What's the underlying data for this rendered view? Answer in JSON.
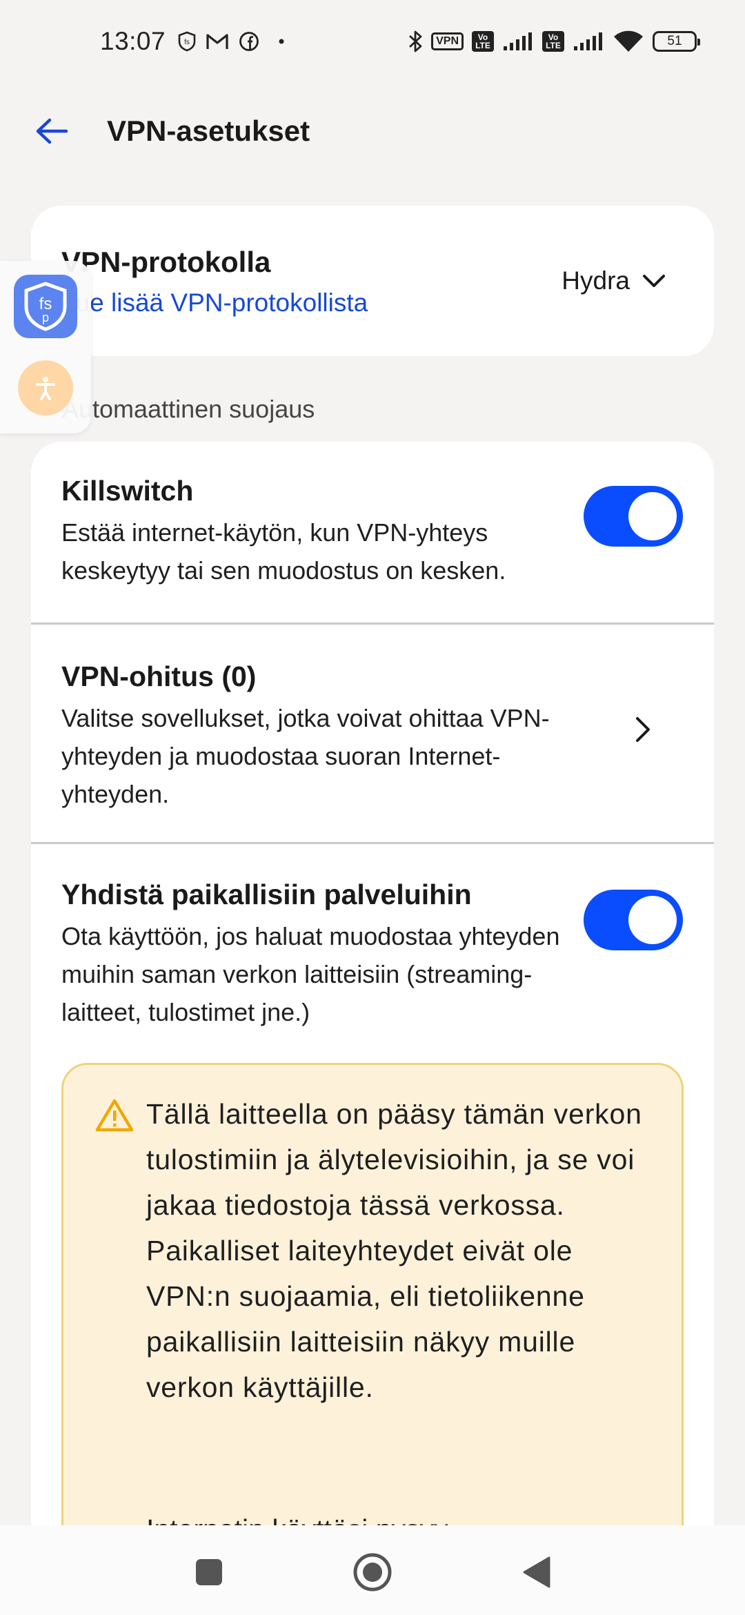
{
  "status_bar": {
    "time": "13:07",
    "vpn_badge": "VPN",
    "volte_1": "Vo\nLTE",
    "volte_2": "Vo\nLTE",
    "battery": "51",
    "icons_left": [
      "shield-fsp-icon",
      "gmail-icon",
      "facebook-icon",
      "dot-icon"
    ],
    "icons_right": [
      "bluetooth-icon",
      "vpn-icon",
      "volte-icon",
      "signal-icon",
      "volte-icon",
      "signal-icon",
      "wifi-icon",
      "battery-icon"
    ]
  },
  "header": {
    "title": "VPN-asetukset",
    "back_icon": "arrow-left-icon"
  },
  "protocol": {
    "title": "VPN-protokolla",
    "link": "Lue lisää VPN-protokollista",
    "selected": "Hydra"
  },
  "section": {
    "label": "Automaattinen suojaus"
  },
  "settings": {
    "killswitch": {
      "title": "Killswitch",
      "desc": "Estää internet-käytön, kun VPN-yhteys keskeytyy tai sen muodostus on kesken.",
      "enabled": true
    },
    "bypass": {
      "title": "VPN-ohitus (0)",
      "desc": "Valitse sovellukset, jotka voivat ohittaa VPN-yhteyden ja muodostaa suoran Internet-yhteyden."
    },
    "local": {
      "title": "Yhdistä paikallisiin palveluihin",
      "desc": "Ota käyttöön, jos haluat muodostaa yhteyden muihin saman verkon laitteisiin (streaming-laitteet, tulostimet jne.)",
      "enabled": true
    }
  },
  "warning": {
    "text": "Tällä laitteella on pääsy tämän verkon tulostimiin ja älytelevisioihin, ja se voi jakaa tiedostoja tässä verkossa. Paikalliset laiteyhteydet eivät ole VPN:n suojaamia, eli tietoliikenne paikallisiin laitteisiin näkyy muille verkon käyttäjille.",
    "text2": "Internetin käyttösi pysyy"
  },
  "colors": {
    "accent": "#0a4dff",
    "link": "#1748d6",
    "warning_bg": "#fdf1da",
    "warning_border": "#f0d27a"
  }
}
